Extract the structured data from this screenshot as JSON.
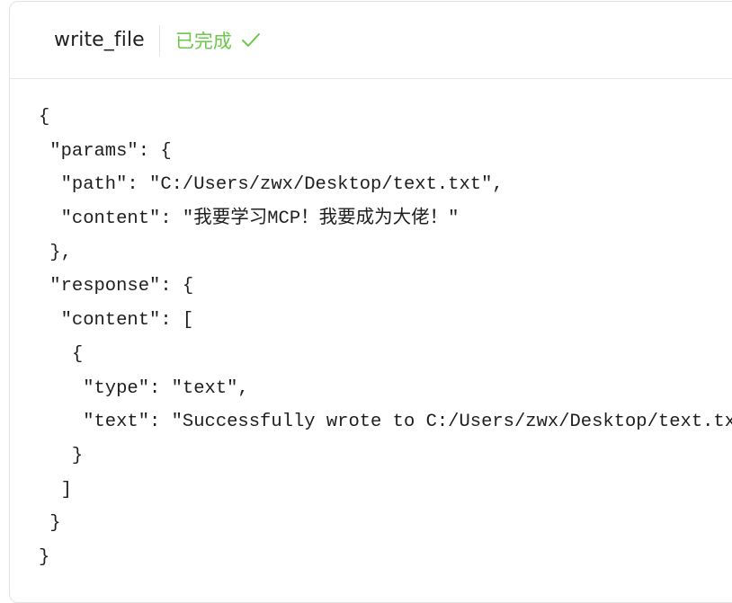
{
  "header": {
    "tool_name": "write_file",
    "status": "已完成",
    "status_icon": "check-icon",
    "status_color": "#6cc84a"
  },
  "code": {
    "lines": [
      "{",
      " \"params\": {",
      "  \"path\": \"C:/Users/zwx/Desktop/text.txt\",",
      "  \"content\": \"我要学习MCP！我要成为大佬！\"",
      " },",
      " \"response\": {",
      "  \"content\": [",
      "   {",
      "    \"type\": \"text\",",
      "    \"text\": \"Successfully wrote to C:/Users/zwx/Desktop/text.txt\"",
      "   }",
      "  ]",
      " }",
      "}"
    ]
  }
}
